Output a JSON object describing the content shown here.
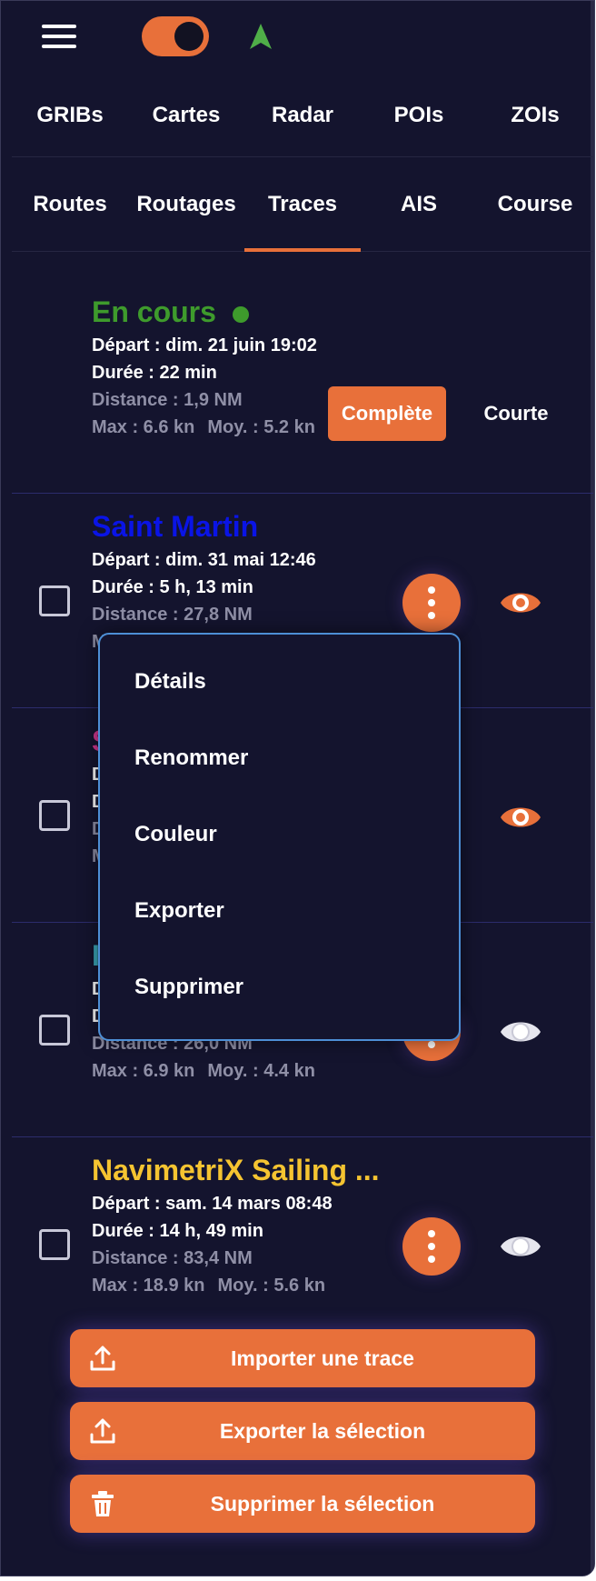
{
  "menu_tabs": [
    "GRIBs",
    "Cartes",
    "Radar",
    "POIs",
    "ZOIs"
  ],
  "sub_tabs": [
    "Routes",
    "Routages",
    "Traces",
    "AIS",
    "Course"
  ],
  "current": {
    "name": "En cours",
    "depart": "Départ : dim. 21 juin 19:02",
    "duree": "Durée : 22 min",
    "distance": "Distance : 1,9 NM",
    "max": "Max : 6.6 kn",
    "moy": "Moy. : 5.2 kn",
    "complete_label": "Complète",
    "short_label": "Courte"
  },
  "tracks": [
    {
      "name": "Saint Martin",
      "depart": "Départ : dim. 31 mai 12:46",
      "duree": "Durée : 5 h, 13 min",
      "distance": "Distance : 27,8 NM",
      "max_prefix": "M"
    },
    {
      "name": "S",
      "depart": "D",
      "duree": "D",
      "distance": "D",
      "max_prefix": "M"
    },
    {
      "name": "I",
      "depart": "D",
      "duree": "D",
      "distance": "Distance : 26,0 NM",
      "max": "Max : 6.9 kn",
      "moy": "Moy. : 4.4 kn"
    },
    {
      "name": "NavimetriX Sailing ...",
      "depart": "Départ : sam. 14 mars 08:48",
      "duree": "Durée : 14 h, 49 min",
      "distance": "Distance : 83,4 NM",
      "max": "Max : 18.9 kn",
      "moy": "Moy. : 5.6 kn"
    }
  ],
  "context_menu": [
    "Détails",
    "Renommer",
    "Couleur",
    "Exporter",
    "Supprimer"
  ],
  "actions": {
    "import": "Importer une trace",
    "export": "Exporter la sélection",
    "delete": "Supprimer la sélection"
  },
  "colors": {
    "background": "#14142e",
    "accent": "#e8703a",
    "current_green": "#3e9b2c",
    "track_blue": "#0a14e6",
    "track_pink": "#d1378f",
    "track_teal": "#3aa7b8",
    "track_yellow": "#f5c431",
    "menu_border": "#4d8fd6"
  },
  "icons": {
    "menu": "hamburger-icon",
    "location": "navigation-arrow-icon",
    "visibility": "eye-icon",
    "more": "kebab-menu-icon",
    "upload": "upload-icon",
    "trash": "trash-icon"
  }
}
